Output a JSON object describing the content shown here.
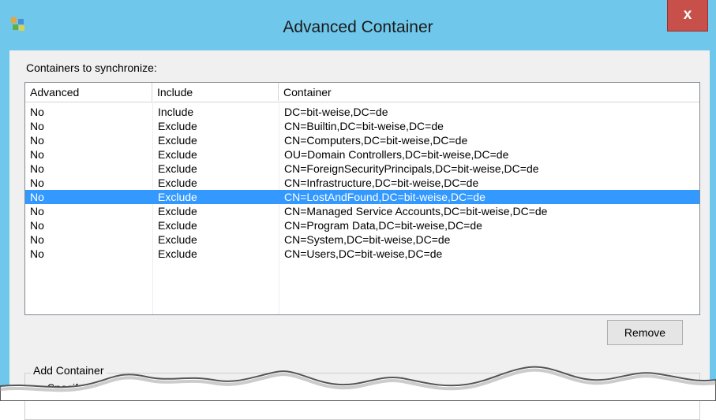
{
  "window": {
    "title": "Advanced Container",
    "close_glyph": "x",
    "app_icon": "application-icon"
  },
  "label_containers": "Containers to synchronize:",
  "listview": {
    "columns": [
      "Advanced",
      "Include",
      "Container"
    ],
    "rows": [
      {
        "advanced": "No",
        "include": "Include",
        "container": "DC=bit-weise,DC=de"
      },
      {
        "advanced": "No",
        "include": "Exclude",
        "container": "CN=Builtin,DC=bit-weise,DC=de"
      },
      {
        "advanced": "No",
        "include": "Exclude",
        "container": "CN=Computers,DC=bit-weise,DC=de"
      },
      {
        "advanced": "No",
        "include": "Exclude",
        "container": "OU=Domain Controllers,DC=bit-weise,DC=de"
      },
      {
        "advanced": "No",
        "include": "Exclude",
        "container": "CN=ForeignSecurityPrincipals,DC=bit-weise,DC=de"
      },
      {
        "advanced": "No",
        "include": "Exclude",
        "container": "CN=Infrastructure,DC=bit-weise,DC=de"
      },
      {
        "advanced": "No",
        "include": "Exclude",
        "container": "CN=LostAndFound,DC=bit-weise,DC=de"
      },
      {
        "advanced": "No",
        "include": "Exclude",
        "container": "CN=Managed Service Accounts,DC=bit-weise,DC=de"
      },
      {
        "advanced": "No",
        "include": "Exclude",
        "container": "CN=Program Data,DC=bit-weise,DC=de"
      },
      {
        "advanced": "No",
        "include": "Exclude",
        "container": "CN=System,DC=bit-weise,DC=de"
      },
      {
        "advanced": "No",
        "include": "Exclude",
        "container": "CN=Users,DC=bit-weise,DC=de"
      }
    ],
    "selected_index": 6
  },
  "buttons": {
    "remove": "Remove"
  },
  "add_container": {
    "legend": "Add Container",
    "partial_text": "Specif"
  },
  "colors": {
    "frame": "#6fc8eb",
    "close": "#c7504b",
    "selection": "#3399ff",
    "client": "#f0f0f0"
  }
}
